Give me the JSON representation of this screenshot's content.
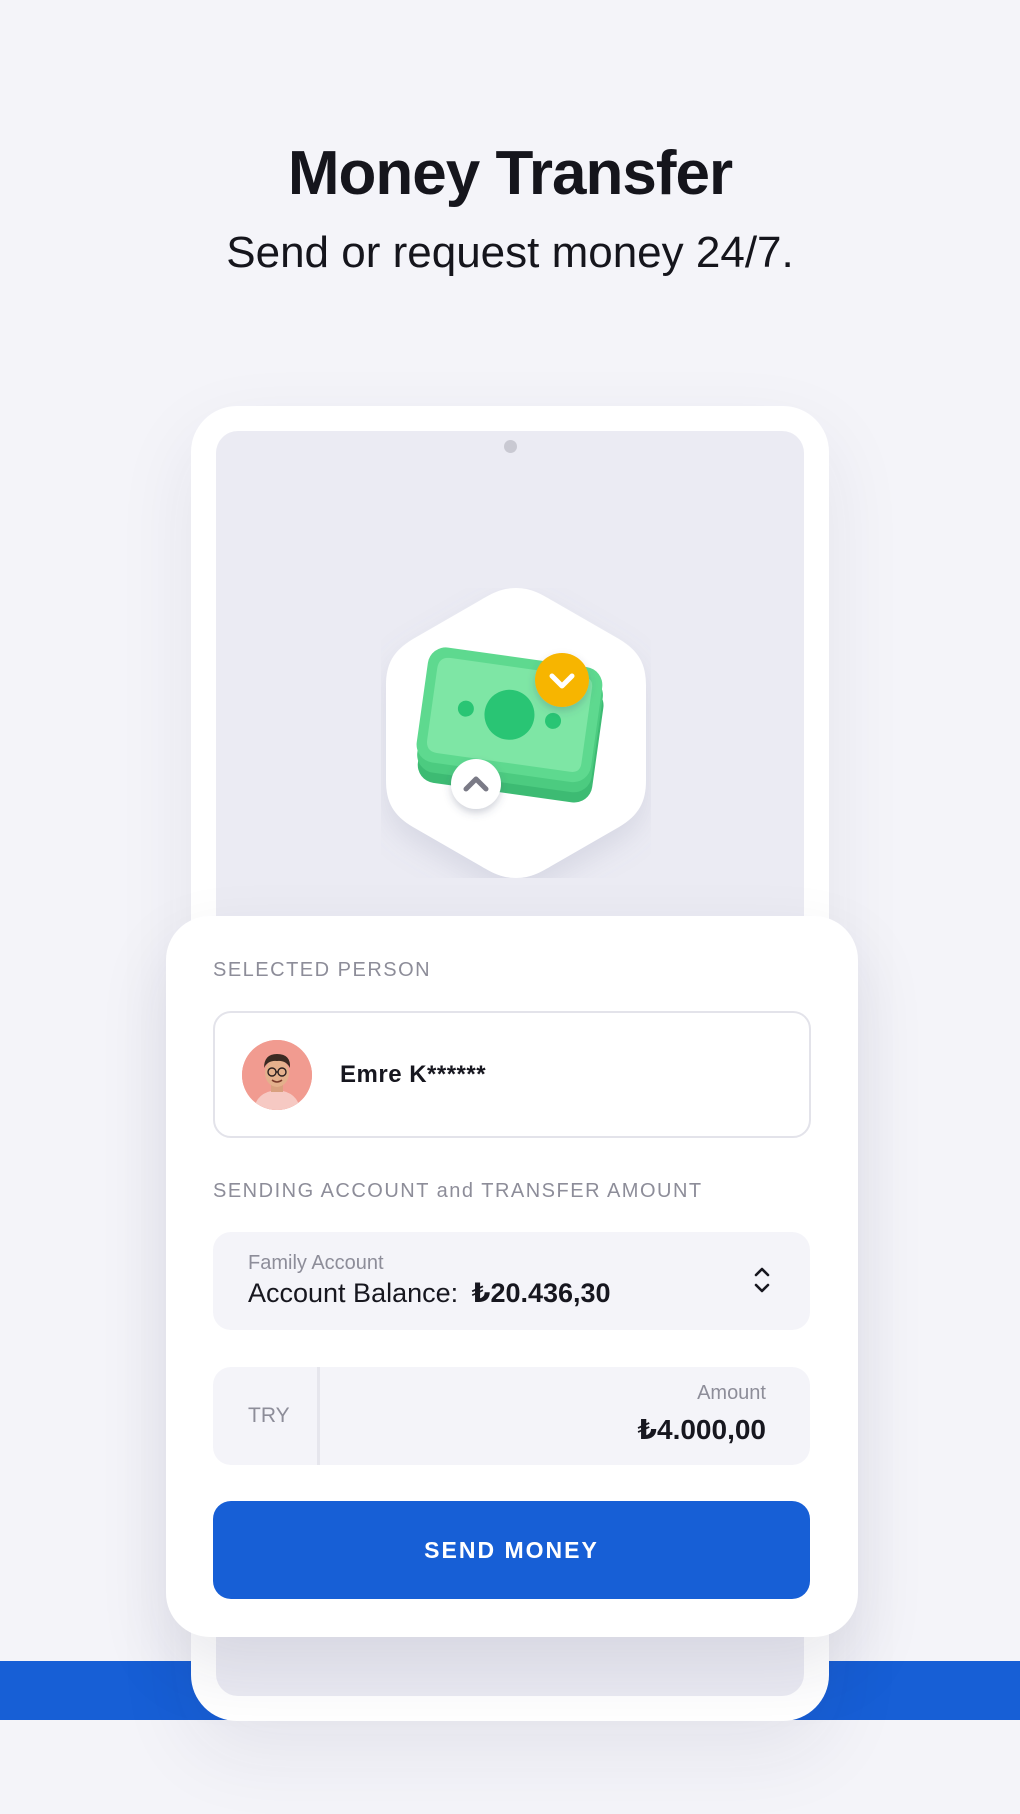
{
  "header": {
    "title": "Money Transfer",
    "subtitle": "Send or request money 24/7."
  },
  "hero": {
    "icon": "cash-transfer-icon",
    "colors": {
      "cash": "#5ed98f",
      "badge": "#f7b500"
    }
  },
  "form": {
    "selected_person_label": "SELECTED PERSON",
    "person": {
      "name": "Emre K******",
      "avatar": "avatar-icon"
    },
    "account_section_label": "SENDING ACCOUNT and TRANSFER AMOUNT",
    "account": {
      "name": "Family Account",
      "balance_label": "Account Balance:",
      "balance_value": "₺20.436,30"
    },
    "amount": {
      "currency": "TRY",
      "label": "Amount",
      "value": "₺4.000,00"
    },
    "send_button_label": "SEND MONEY"
  },
  "colors": {
    "accent": "#175fd6",
    "background": "#f4f4f9"
  }
}
